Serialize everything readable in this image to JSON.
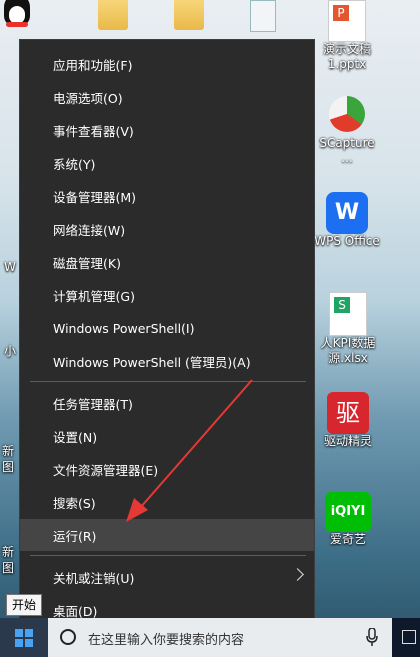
{
  "desktop": {
    "icons": [
      {
        "label": "演示文稿",
        "label2": "1.pptx"
      },
      {
        "label": "SCapture",
        "label2": "..."
      },
      {
        "label": "WPS Office"
      },
      {
        "label": "人KPI数据",
        "label2": "源.xlsx"
      },
      {
        "label": "驱动精灵"
      },
      {
        "label": "爱奇艺"
      }
    ],
    "left_fragments": [
      "W",
      "小",
      "新",
      "图",
      "新",
      "图"
    ]
  },
  "context_menu": {
    "items": [
      "应用和功能(F)",
      "电源选项(O)",
      "事件查看器(V)",
      "系统(Y)",
      "设备管理器(M)",
      "网络连接(W)",
      "磁盘管理(K)",
      "计算机管理(G)",
      "Windows PowerShell(I)",
      "Windows PowerShell (管理员)(A)",
      "任务管理器(T)",
      "设置(N)",
      "文件资源管理器(E)",
      "搜索(S)",
      "运行(R)",
      "关机或注销(U)",
      "桌面(D)"
    ],
    "highlighted": "运行(R)"
  },
  "tooltip": "开始",
  "taskbar": {
    "search_placeholder": "在这里输入你要搜索的内容"
  },
  "colors": {
    "menu_bg": "#2b2b2b",
    "menu_highlight": "#454545",
    "arrow": "#e53935",
    "taskbar": "#0e1a2b"
  }
}
